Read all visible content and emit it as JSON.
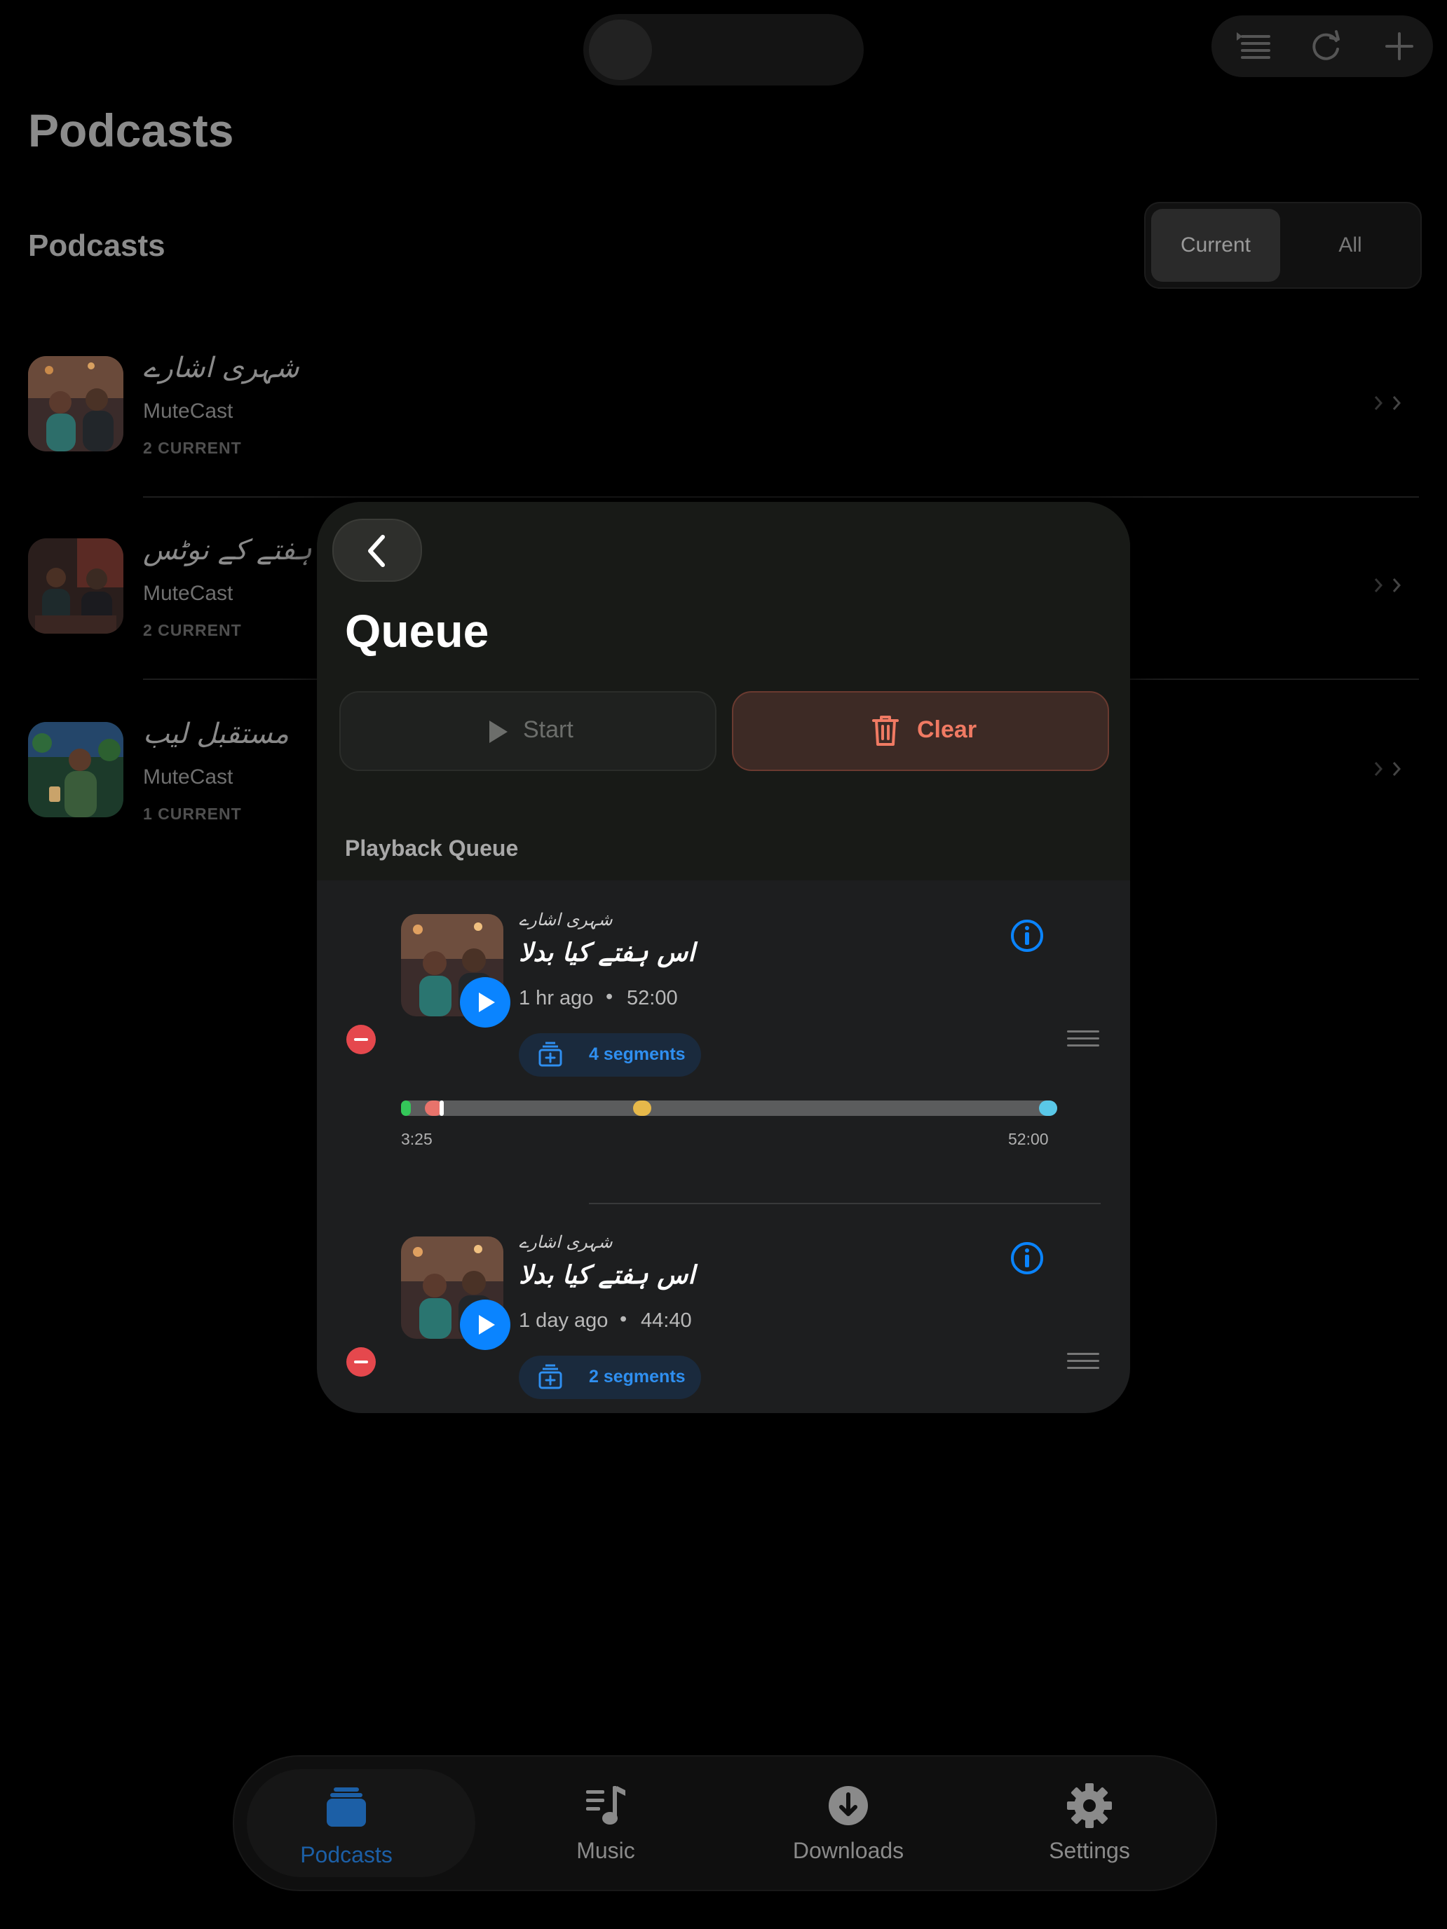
{
  "app": {
    "large_title": "Podcasts",
    "section_title": "Podcasts",
    "filter": {
      "options": [
        "Current",
        "All"
      ],
      "selected": "Current"
    },
    "toolbar_icons": [
      "queue-list-icon",
      "refresh-icon",
      "plus-icon"
    ]
  },
  "podcasts": [
    {
      "title": "شہری اشارے",
      "author": "MuteCast",
      "count": "2 CURRENT"
    },
    {
      "title": "ہفتے کے نوٹس",
      "author": "MuteCast",
      "count": "2 CURRENT"
    },
    {
      "title": "مستقبل لیب",
      "author": "MuteCast",
      "count": "1 CURRENT"
    }
  ],
  "queue": {
    "title": "Queue",
    "start_label": "Start",
    "clear_label": "Clear",
    "section_label": "Playback Queue",
    "items": [
      {
        "podcast": "شہری اشارے",
        "episode": "اس ہفتے کیا بدلا",
        "age": "1 hr ago",
        "separator": "•",
        "duration": "52:00",
        "segments_label": "4 segments",
        "progress_start": "3:25",
        "progress_end": "52:00",
        "segment_marks_fraction": [
          0.0,
          0.05,
          0.367,
          1.0
        ],
        "segment_colors": [
          "#34c759",
          "#e8736b",
          "#e6b84a",
          "#5ac8e8"
        ]
      },
      {
        "podcast": "شہری اشارے",
        "episode": "اس ہفتے کیا بدلا",
        "age": "1 day ago",
        "separator": "•",
        "duration": "44:40",
        "segments_label": "2 segments"
      }
    ]
  },
  "tabs": [
    {
      "label": "Podcasts",
      "icon": "podcasts-stack-icon",
      "active": true
    },
    {
      "label": "Music",
      "icon": "music-note-icon",
      "active": false
    },
    {
      "label": "Downloads",
      "icon": "download-circle-icon",
      "active": false
    },
    {
      "label": "Settings",
      "icon": "gear-icon",
      "active": false
    }
  ],
  "colors": {
    "accent": "#0a84ff",
    "destructive": "#e5484d",
    "clear_text": "#f07a63"
  }
}
